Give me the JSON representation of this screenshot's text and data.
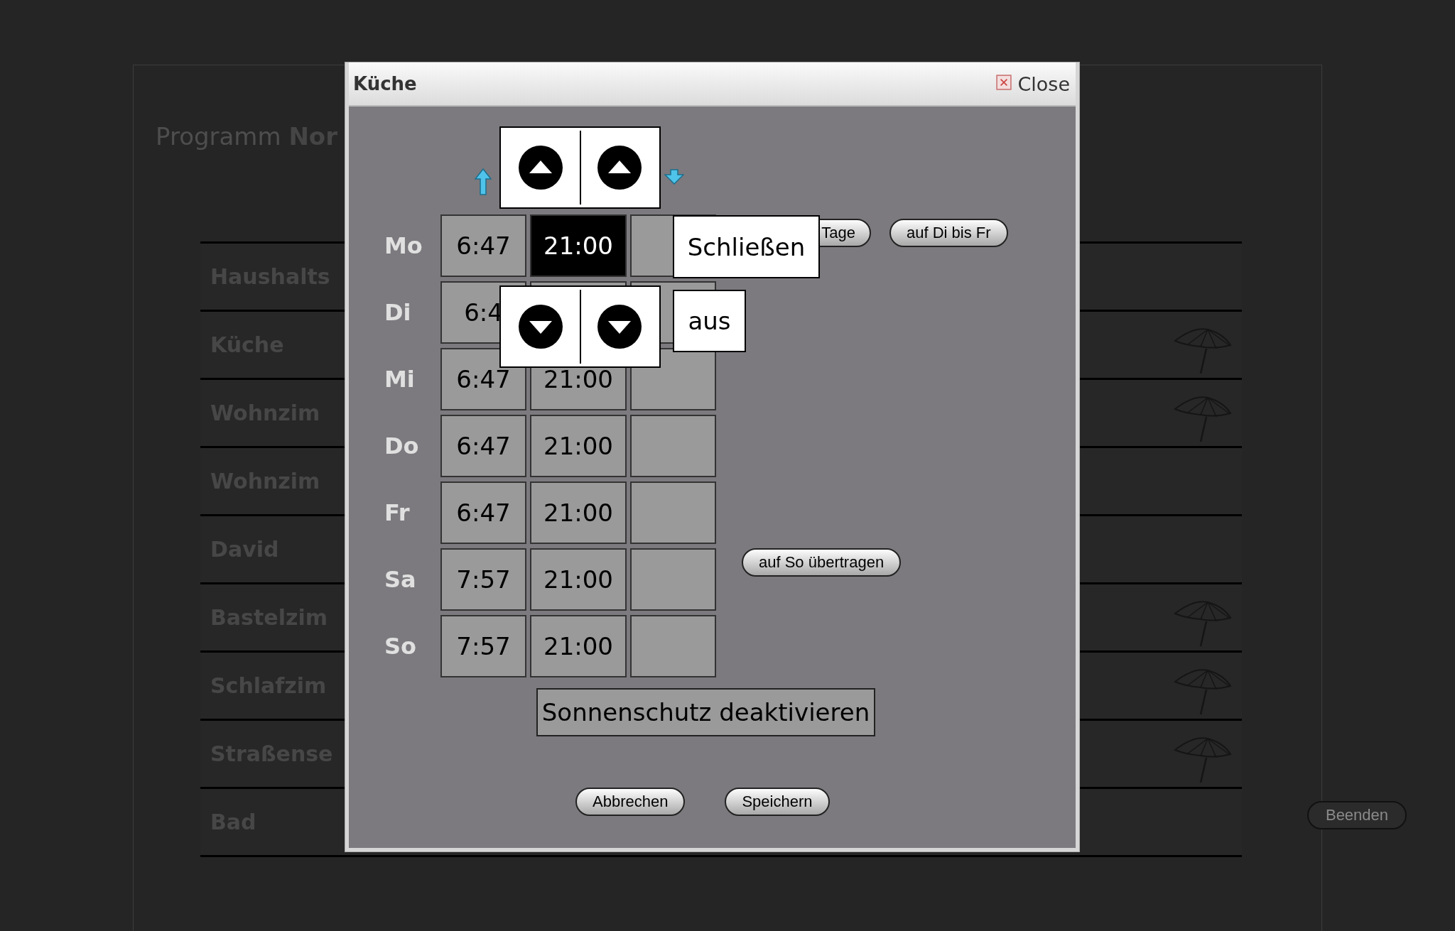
{
  "page": {
    "program_label": "Programm",
    "program_name": "Nor",
    "rooms": [
      {
        "name": "Haushalts",
        "shaded": false
      },
      {
        "name": "Küche",
        "shaded": true
      },
      {
        "name": "Wohnzim",
        "shaded": true
      },
      {
        "name": "Wohnzim",
        "shaded": false
      },
      {
        "name": "David",
        "shaded": false
      },
      {
        "name": "Bastelzim",
        "shaded": true
      },
      {
        "name": "Schlafzim",
        "shaded": true
      },
      {
        "name": "Straßense",
        "shaded": true
      },
      {
        "name": "Bad",
        "shaded": false
      }
    ],
    "quit_button": "Beenden"
  },
  "dialog": {
    "title": "Küche",
    "close": "Close",
    "schedule": [
      {
        "day": "Mo",
        "cells": [
          {
            "value": "6:47",
            "selected": false
          },
          {
            "value": "21:00",
            "selected": true
          }
        ],
        "actions": [
          "Tage",
          "auf Di bis Fr"
        ]
      },
      {
        "day": "Di",
        "cells": [
          {
            "value": "6:4",
            "selected": false
          },
          {
            "selected": false
          }
        ]
      },
      {
        "day": "Mi",
        "cells": [
          {
            "value": "6:47",
            "selected": false
          },
          {
            "value": "21:00",
            "selected": false
          }
        ]
      },
      {
        "day": "Do",
        "cells": [
          {
            "value": "6:47",
            "selected": false
          },
          {
            "value": "21:00",
            "selected": false
          }
        ]
      },
      {
        "day": "Fr",
        "cells": [
          {
            "value": "6:47",
            "selected": false
          },
          {
            "value": "21:00",
            "selected": false
          }
        ]
      },
      {
        "day": "Sa",
        "cells": [
          {
            "value": "7:57",
            "selected": false
          },
          {
            "value": "21:00",
            "selected": false
          }
        ],
        "actions": [
          "auf So übertragen"
        ]
      },
      {
        "day": "So",
        "cells": [
          {
            "value": "7:57",
            "selected": false
          },
          {
            "value": "21:00",
            "selected": false
          }
        ]
      }
    ],
    "picker": {
      "close": "Schließen",
      "mode": "aus"
    },
    "sun_protection": "Sonnenschutz deaktivieren",
    "buttons": [
      "Abbrechen",
      "Speichern"
    ]
  }
}
